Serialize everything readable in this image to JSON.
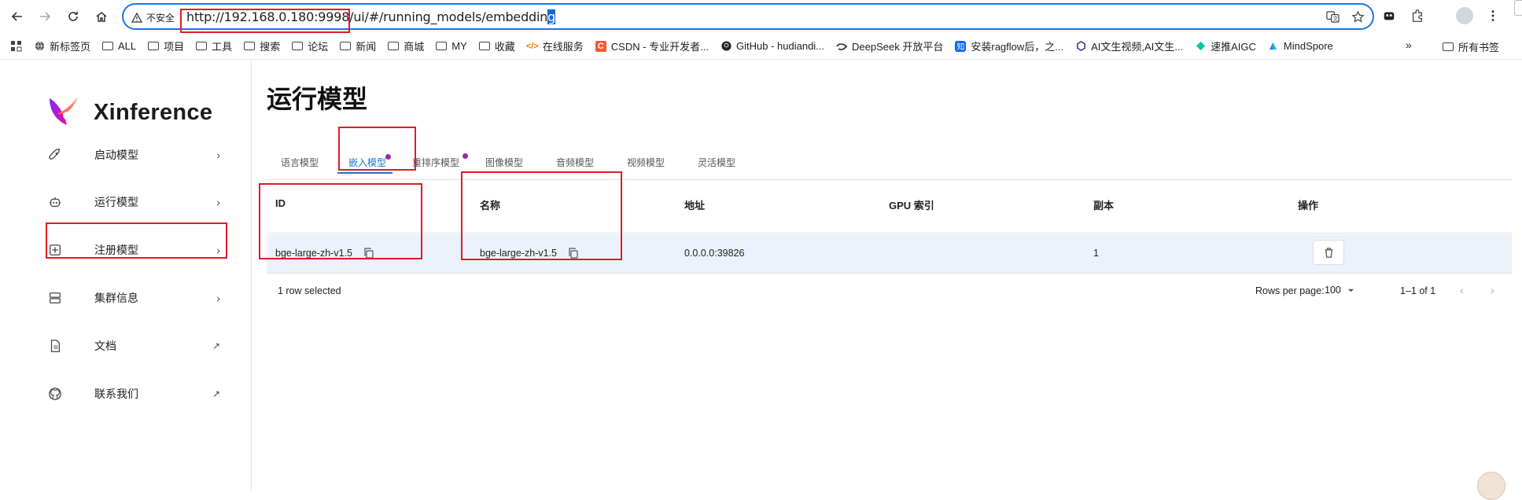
{
  "browser": {
    "security_label": "不安全",
    "url_main": "http://192.168.0.180:9998/ui/#/running_models/embeddin",
    "url_selected": "g"
  },
  "bookmarks": [
    {
      "label": "新标签页",
      "icon": "globe-icon"
    },
    {
      "label": "ALL",
      "icon": "folder-icon"
    },
    {
      "label": "项目",
      "icon": "folder-icon"
    },
    {
      "label": "工具",
      "icon": "folder-icon"
    },
    {
      "label": "搜索",
      "icon": "folder-icon"
    },
    {
      "label": "论坛",
      "icon": "folder-icon"
    },
    {
      "label": "新闻",
      "icon": "folder-icon"
    },
    {
      "label": "商城",
      "icon": "folder-icon"
    },
    {
      "label": "MY",
      "icon": "folder-icon"
    },
    {
      "label": "收藏",
      "icon": "folder-icon"
    },
    {
      "label": "在线服务",
      "icon": "service-icon"
    },
    {
      "label": "CSDN - 专业开发者...",
      "icon": "csdn-icon"
    },
    {
      "label": "GitHub - hudiandi...",
      "icon": "github-icon"
    },
    {
      "label": "DeepSeek 开放平台",
      "icon": "deepseek-icon"
    },
    {
      "label": "安装ragflow后，之...",
      "icon": "zhihu-icon"
    },
    {
      "label": "AI文生视频,AI文生...",
      "icon": "ai-icon"
    },
    {
      "label": "速推AIGC",
      "icon": "aigc-icon"
    },
    {
      "label": "MindSpore",
      "icon": "mindspore-icon"
    }
  ],
  "bookmarks_more": "»",
  "bookmarks_all": "所有书签",
  "app": {
    "brand": "Xinference",
    "sidebar": [
      {
        "label": "启动模型",
        "icon": "rocket-icon",
        "arrow": "›"
      },
      {
        "label": "运行模型",
        "icon": "robot-icon",
        "arrow": "›"
      },
      {
        "label": "注册模型",
        "icon": "plus-box-icon",
        "arrow": "›"
      },
      {
        "label": "集群信息",
        "icon": "server-icon",
        "arrow": "›"
      },
      {
        "label": "文档",
        "icon": "document-icon",
        "arrow": "↗"
      },
      {
        "label": "联系我们",
        "icon": "github-icon",
        "arrow": "↗"
      }
    ],
    "page_title": "运行模型",
    "tabs": [
      "语言模型",
      "嵌入模型",
      "重排序模型",
      "图像模型",
      "音频模型",
      "视频模型",
      "灵活模型"
    ],
    "active_tab": "嵌入模型",
    "table": {
      "headers": [
        "ID",
        "名称",
        "地址",
        "GPU 索引",
        "副本",
        "操作"
      ],
      "rows": [
        {
          "id": "bge-large-zh-v1.5",
          "name": "bge-large-zh-v1.5",
          "address": "0.0.0.0:39826",
          "gpu_index": "",
          "replicas": "1"
        }
      ]
    },
    "footer": {
      "selected": "1 row selected",
      "rows_per_page_label": "Rows per page:",
      "rows_per_page_value": "100",
      "range": "1–1 of 1"
    }
  },
  "colors": {
    "accent": "#1976d2",
    "annotation": "#e01b24",
    "selected_row": "#ebf2fb",
    "tab_dot": "#9c27b0"
  }
}
